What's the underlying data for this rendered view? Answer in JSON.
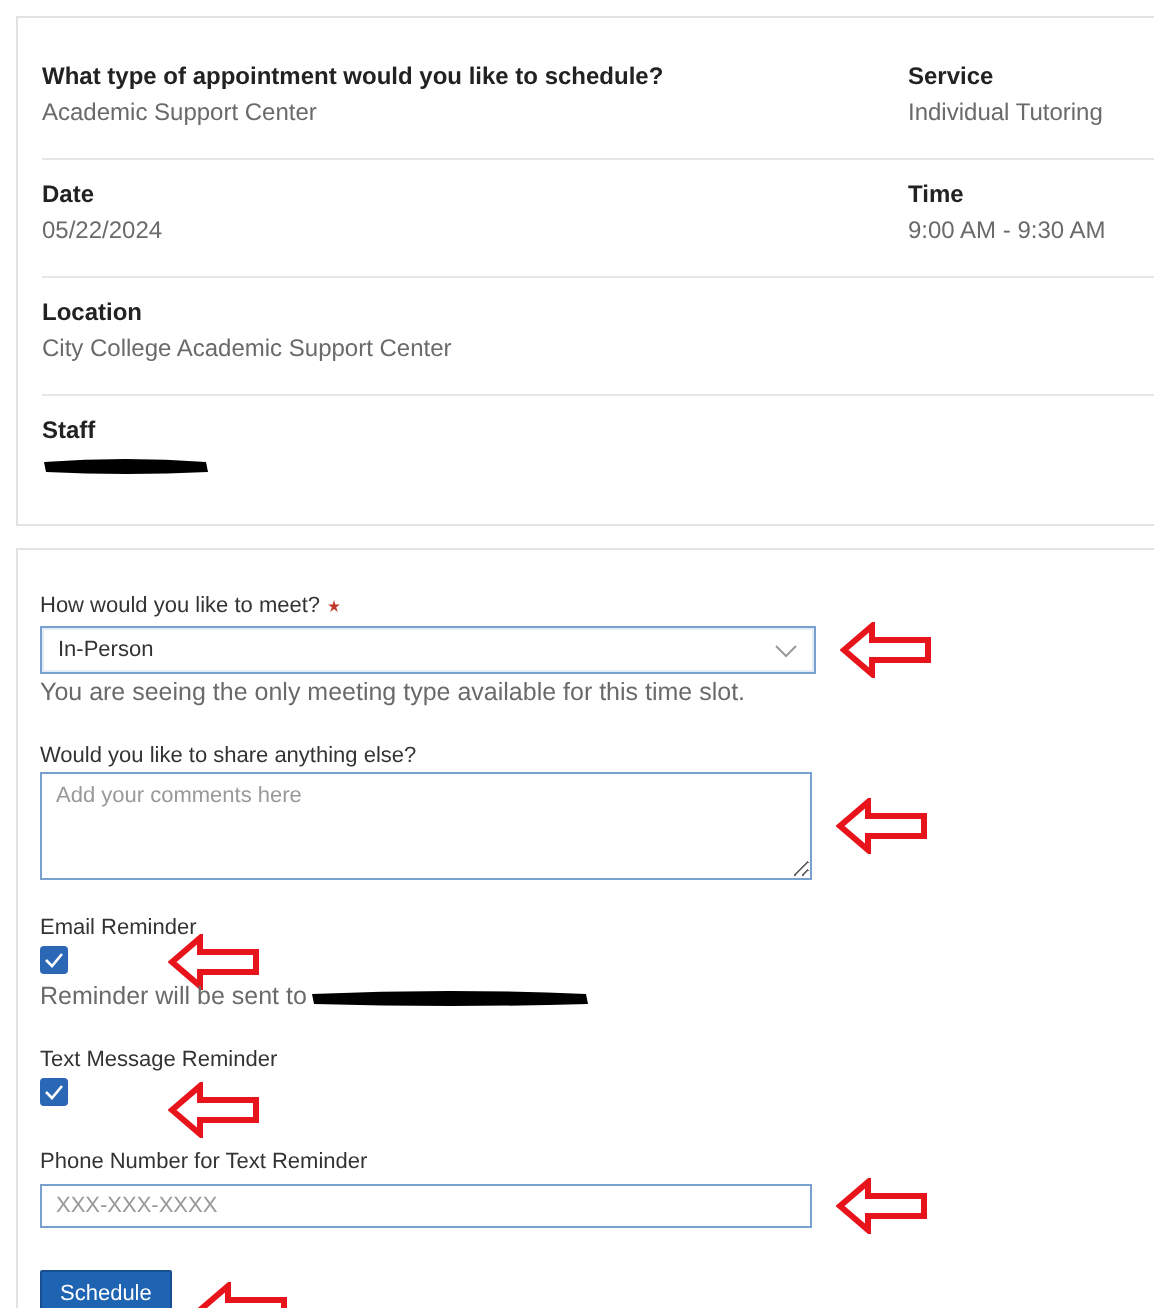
{
  "summary": {
    "rows": [
      {
        "left": {
          "label": "What type of appointment would you like to schedule?",
          "value": "Academic Support Center"
        },
        "right": {
          "label": "Service",
          "value": "Individual Tutoring"
        }
      },
      {
        "left": {
          "label": "Date",
          "value": "05/22/2024"
        },
        "right": {
          "label": "Time",
          "value": "9:00 AM - 9:30 AM"
        }
      },
      {
        "left": {
          "label": "Location",
          "value": "City College Academic Support Center"
        }
      },
      {
        "left": {
          "label": "Staff",
          "redacted": true
        }
      }
    ]
  },
  "form": {
    "meeting": {
      "label": "How would you like to meet?",
      "required": true,
      "value": "In-Person",
      "help": "You are seeing the only meeting type available for this time slot."
    },
    "comments": {
      "label": "Would you like to share anything else?",
      "placeholder": "Add your comments here"
    },
    "email_reminder": {
      "label": "Email Reminder",
      "checked": true,
      "note": "Reminder will be sent to"
    },
    "text_reminder": {
      "label": "Text Message Reminder",
      "checked": true
    },
    "phone": {
      "label": "Phone Number for Text Reminder",
      "placeholder": "XXX-XXX-XXXX"
    },
    "submit": "Schedule"
  }
}
